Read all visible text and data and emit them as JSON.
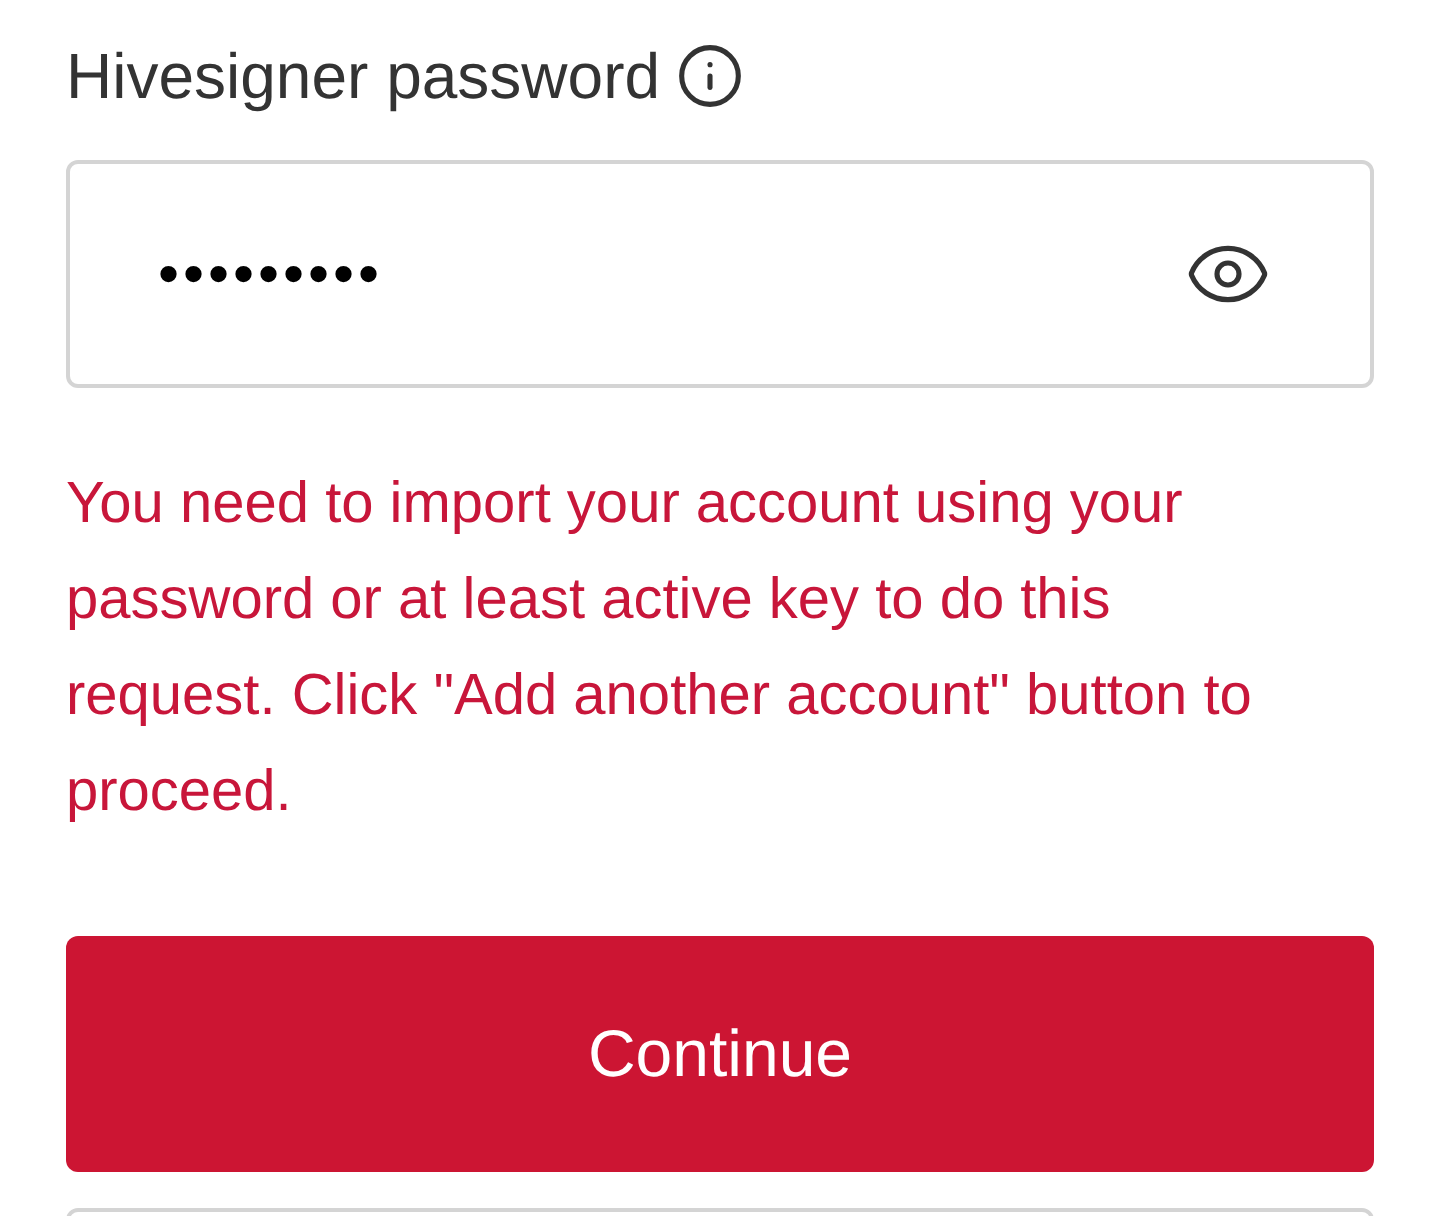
{
  "password_field": {
    "label": "Hivesigner password",
    "value": "•••••••••",
    "masked": true
  },
  "error_message": "You need to import your account using your password or at least active key to do this request. Click \"Add another account\" button to proceed.",
  "buttons": [
    {
      "label": "Continue",
      "kind": "primary"
    }
  ]
}
